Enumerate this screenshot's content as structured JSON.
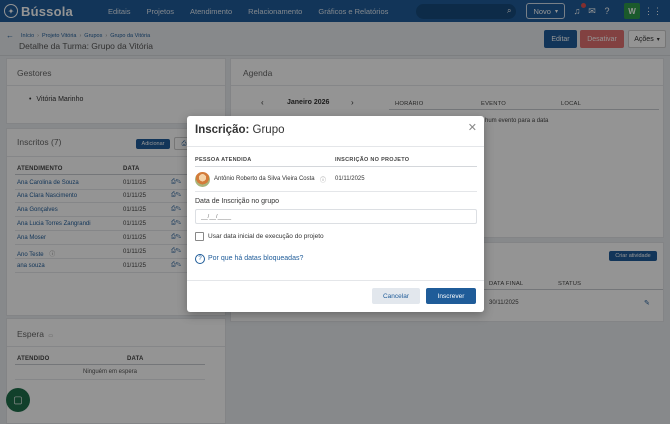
{
  "nav": {
    "brand": "Bússola",
    "links": [
      "Editais",
      "Projetos",
      "Atendimento",
      "Relacionamento",
      "Gráficos e Relatórios"
    ],
    "novo_label": "Novo",
    "user_initial": "W",
    "colors": {
      "primary": "#1f5c99",
      "danger": "#e07070",
      "success": "#2f9c4c"
    }
  },
  "breadcrumb": [
    "Início",
    "Projeto Vitória",
    "Grupos",
    "Grupo da Vitória"
  ],
  "page_title": "Detalhe da Turma: Grupo da Vitória",
  "actions": {
    "edit": "Editar",
    "deactivate": "Desativar",
    "more": "Ações"
  },
  "gestores": {
    "title": "Gestores",
    "items": [
      "Vitória Marinho"
    ]
  },
  "inscritos": {
    "title": "Inscritos (7)",
    "add_label": "Adicionar",
    "columns": [
      "ATENDIMENTO",
      "DATA"
    ],
    "rows": [
      {
        "name": "Ana Carolina de Souza",
        "date": "01/11/25"
      },
      {
        "name": "Ana Clara Nascimento",
        "date": "01/11/25"
      },
      {
        "name": "Ana Gonçalves",
        "date": "01/11/25"
      },
      {
        "name": "Ana Lucia Torres Zangrandi",
        "date": "01/11/25"
      },
      {
        "name": "Ana Moser",
        "date": "01/11/25"
      },
      {
        "name": "Ano Teste",
        "date": "01/11/25"
      },
      {
        "name": "ana souza",
        "date": "01/11/25"
      }
    ]
  },
  "espera": {
    "title": "Espera",
    "columns": [
      "ATENDIDO",
      "DATA"
    ],
    "empty": "Ninguém em espera"
  },
  "agenda": {
    "title": "Agenda",
    "month": "Janeiro 2026",
    "columns": [
      "HORÁRIO",
      "EVENTO",
      "LOCAL"
    ],
    "empty_fragment": "hum evento para a data"
  },
  "atividades": {
    "create_label": "Criar atividade",
    "columns": [
      "DATA FINAL",
      "STATUS"
    ],
    "row_end_date": "30/11/2025"
  },
  "modal": {
    "title_bold": "Inscrição:",
    "title_rest": " Grupo",
    "columns": [
      "PESSOA ATENDIDA",
      "INSCRIÇÃO NO PROJETO"
    ],
    "person": "Antônio Roberto da Silva Vieira Costa",
    "project_date": "01/11/2025",
    "date_label": "Data de Inscrição no grupo",
    "date_placeholder": "__/__/____",
    "checkbox_label": "Usar data inicial de execução do projeto",
    "help_link": "Por que há datas bloqueadas?",
    "cancel": "Cancelar",
    "submit": "Inscrever"
  }
}
